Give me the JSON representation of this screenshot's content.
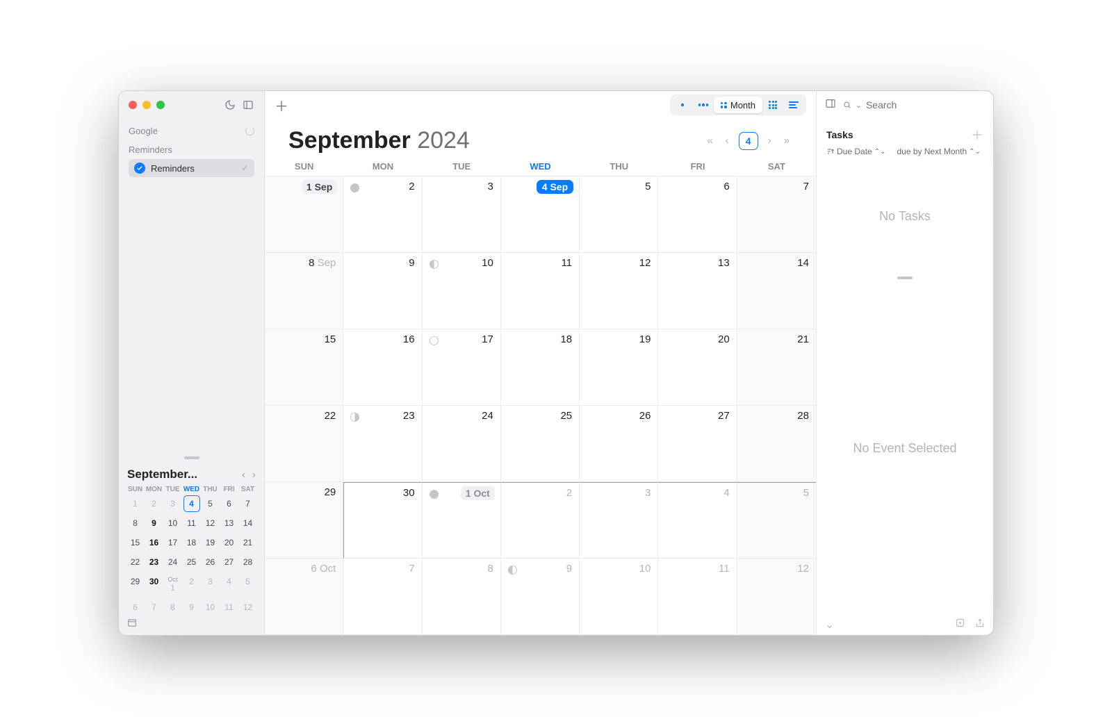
{
  "sidebar": {
    "accounts": [
      {
        "name": "Google",
        "loading": true
      },
      {
        "name": "Reminders",
        "calendars": [
          {
            "label": "Reminders",
            "checked": true,
            "selected": true
          }
        ]
      }
    ],
    "mini_cal": {
      "title": "September...",
      "dow": [
        "SUN",
        "MON",
        "TUE",
        "WED",
        "THU",
        "FRI",
        "SAT"
      ],
      "today_col": 3,
      "rows": [
        [
          {
            "n": "1",
            "dim": true
          },
          {
            "n": "2",
            "dim": true
          },
          {
            "n": "3",
            "dim": true
          },
          {
            "n": "4",
            "today": true
          },
          {
            "n": "5"
          },
          {
            "n": "6"
          },
          {
            "n": "7"
          }
        ],
        [
          {
            "n": "8"
          },
          {
            "n": "9",
            "bold": true
          },
          {
            "n": "10"
          },
          {
            "n": "11"
          },
          {
            "n": "12"
          },
          {
            "n": "13"
          },
          {
            "n": "14"
          }
        ],
        [
          {
            "n": "15"
          },
          {
            "n": "16",
            "bold": true
          },
          {
            "n": "17"
          },
          {
            "n": "18"
          },
          {
            "n": "19"
          },
          {
            "n": "20"
          },
          {
            "n": "21"
          }
        ],
        [
          {
            "n": "22"
          },
          {
            "n": "23",
            "bold": true
          },
          {
            "n": "24"
          },
          {
            "n": "25"
          },
          {
            "n": "26"
          },
          {
            "n": "27"
          },
          {
            "n": "28"
          }
        ],
        [
          {
            "n": "29"
          },
          {
            "n": "30",
            "bold": true
          },
          {
            "sup": "Oct",
            "n": "1",
            "dim": true
          },
          {
            "n": "2",
            "dim": true
          },
          {
            "n": "3",
            "dim": true
          },
          {
            "n": "4",
            "dim": true
          },
          {
            "n": "5",
            "dim": true
          }
        ],
        [
          {
            "n": "6",
            "dim": true
          },
          {
            "n": "7",
            "dim": true
          },
          {
            "n": "8",
            "dim": true
          },
          {
            "n": "9",
            "dim": true
          },
          {
            "n": "10",
            "dim": true
          },
          {
            "n": "11",
            "dim": true
          },
          {
            "n": "12",
            "dim": true
          }
        ]
      ]
    }
  },
  "toolbar": {
    "view_label": "Month",
    "today_number": "4"
  },
  "main": {
    "month": "September",
    "year": "2024",
    "dow": [
      "SUN",
      "MON",
      "TUE",
      "WED",
      "THU",
      "FRI",
      "SAT"
    ],
    "today_col": 3,
    "weeks": [
      [
        {
          "label": "1 Sep",
          "badge": "month",
          "in": true,
          "weekend": true
        },
        {
          "n": "2",
          "in": true,
          "moon": "new"
        },
        {
          "n": "3",
          "in": true
        },
        {
          "label": "4 Sep",
          "badge": "today",
          "in": true
        },
        {
          "n": "5",
          "in": true
        },
        {
          "n": "6",
          "in": true
        },
        {
          "n": "7",
          "in": true,
          "weekend": true
        }
      ],
      [
        {
          "label": "8 Sep",
          "in": true,
          "weekend": true,
          "split": true
        },
        {
          "n": "9",
          "in": true
        },
        {
          "n": "10",
          "in": true,
          "moon": "fq"
        },
        {
          "n": "11",
          "in": true
        },
        {
          "n": "12",
          "in": true
        },
        {
          "n": "13",
          "in": true
        },
        {
          "n": "14",
          "in": true,
          "weekend": true
        }
      ],
      [
        {
          "n": "15",
          "in": true,
          "weekend": true
        },
        {
          "n": "16",
          "in": true
        },
        {
          "n": "17",
          "in": true,
          "moon": "full"
        },
        {
          "n": "18",
          "in": true
        },
        {
          "n": "19",
          "in": true
        },
        {
          "n": "20",
          "in": true
        },
        {
          "n": "21",
          "in": true,
          "weekend": true
        }
      ],
      [
        {
          "n": "22",
          "in": true,
          "weekend": true
        },
        {
          "n": "23",
          "in": true,
          "moon": "lq"
        },
        {
          "n": "24",
          "in": true
        },
        {
          "n": "25",
          "in": true
        },
        {
          "n": "26",
          "in": true
        },
        {
          "n": "27",
          "in": true
        },
        {
          "n": "28",
          "in": true,
          "weekend": true
        }
      ],
      [
        {
          "n": "29",
          "in": true,
          "weekend": true
        },
        {
          "n": "30",
          "in": true
        },
        {
          "label": "1 Oct",
          "badge": "month-out",
          "moon": "new"
        },
        {
          "n": "2"
        },
        {
          "n": "3"
        },
        {
          "n": "4"
        },
        {
          "n": "5",
          "weekend": true
        }
      ],
      [
        {
          "label": "6 Oct",
          "weekend": true,
          "split": true
        },
        {
          "n": "7"
        },
        {
          "n": "8"
        },
        {
          "n": "9",
          "moon": "fq"
        },
        {
          "n": "10"
        },
        {
          "n": "11"
        },
        {
          "n": "12",
          "weekend": true
        }
      ]
    ]
  },
  "panel": {
    "search_placeholder": "Search",
    "tasks_title": "Tasks",
    "sort_label": "Due Date",
    "filter_label": "due by Next Month",
    "no_tasks": "No Tasks",
    "no_event": "No Event Selected"
  }
}
